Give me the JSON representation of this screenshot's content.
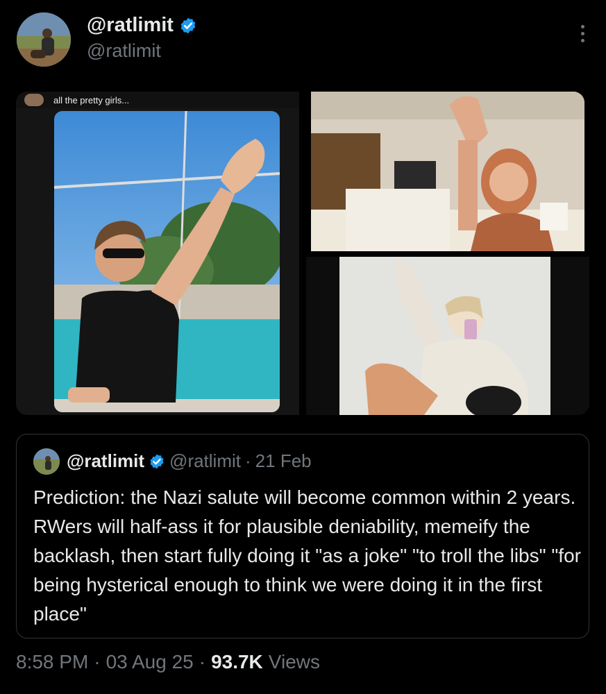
{
  "author": {
    "display_name": "@ratlimit",
    "handle": "@ratlimit"
  },
  "media": {
    "left_caption": "all the pretty girls..."
  },
  "quoted_tweet": {
    "display_name": "@ratlimit",
    "handle": "@ratlimit",
    "separator": "·",
    "date": "21 Feb",
    "text": "Prediction: the Nazi salute will become common within 2 years. RWers will half-ass it for plausible deniability, memeify the backlash, then start fully doing it \"as a joke\" \"to troll the libs\" \"for being hysterical enough to think we were doing it in the first place\""
  },
  "meta": {
    "time": "8:58 PM",
    "sep1": "·",
    "date": "03 Aug 25",
    "sep2": "·",
    "views_count": "93.7K",
    "views_label": "Views"
  },
  "colors": {
    "background": "#000000",
    "text_primary": "#e7e9ea",
    "text_secondary": "#71767b",
    "verified_blue": "#1d9bf0",
    "border": "#2f3336"
  },
  "icons": [
    "verified-badge-icon",
    "more-options-icon"
  ]
}
